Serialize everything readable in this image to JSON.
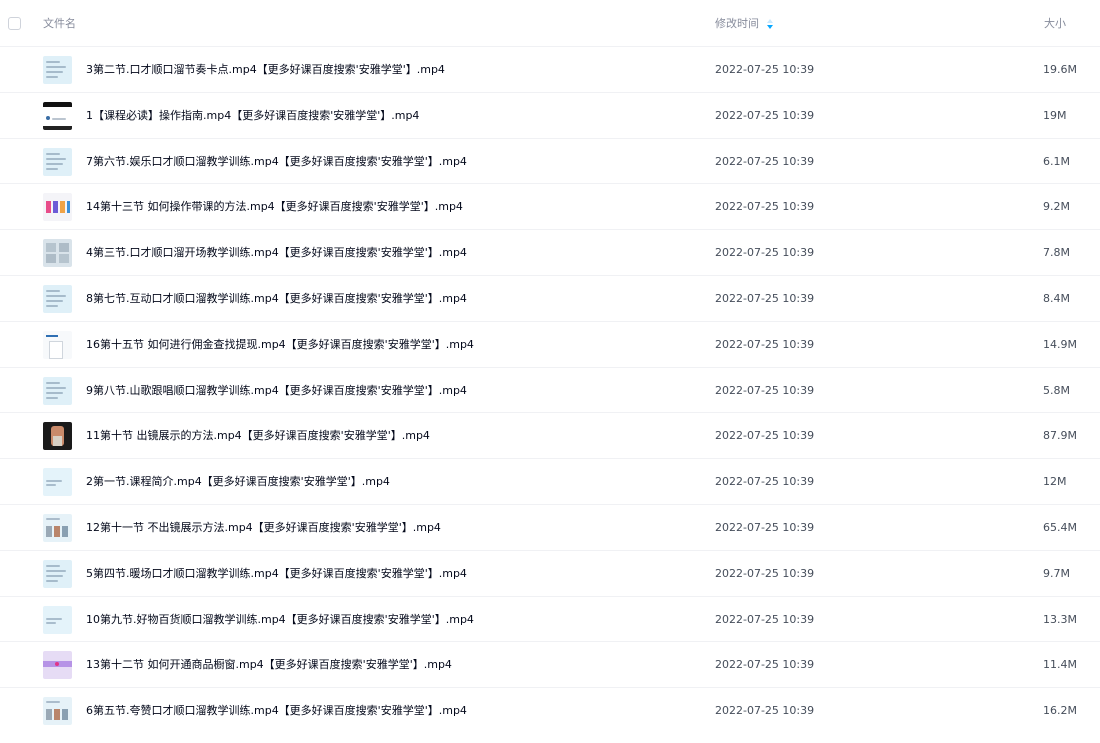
{
  "header": {
    "name_label": "文件名",
    "time_label": "修改时间",
    "size_label": "大小"
  },
  "colors": {
    "accent": "#06a7ff",
    "header_text": "#878c9c",
    "name_text": "#03081a",
    "meta_text": "#454d5a",
    "divider": "#f0f1f4"
  },
  "files": [
    {
      "name": "3第二节.口才顺口溜节奏卡点.mp4【更多好课百度搜索'安雅学堂'】.mp4",
      "time": "2022-07-25 10:39",
      "size": "19.6M",
      "thumb": "slide-light"
    },
    {
      "name": "1【课程必读】操作指南.mp4【更多好课百度搜索'安雅学堂'】.mp4",
      "time": "2022-07-25 10:39",
      "size": "19M",
      "thumb": "dark-phone"
    },
    {
      "name": "7第六节.娱乐口才顺口溜教学训练.mp4【更多好课百度搜索'安雅学堂'】.mp4",
      "time": "2022-07-25 10:39",
      "size": "6.1M",
      "thumb": "slide-light"
    },
    {
      "name": "14第十三节 如何操作带课的方法.mp4【更多好课百度搜索'安雅学堂'】.mp4",
      "time": "2022-07-25 10:39",
      "size": "9.2M",
      "thumb": "colorful"
    },
    {
      "name": "4第三节.口才顺口溜开场教学训练.mp4【更多好课百度搜索'安雅学堂'】.mp4",
      "time": "2022-07-25 10:39",
      "size": "7.8M",
      "thumb": "grid-gray"
    },
    {
      "name": "8第七节.互动口才顺口溜教学训练.mp4【更多好课百度搜索'安雅学堂'】.mp4",
      "time": "2022-07-25 10:39",
      "size": "8.4M",
      "thumb": "slide-light"
    },
    {
      "name": "16第十五节 如何进行佣金查找提现.mp4【更多好课百度搜索'安雅学堂'】.mp4",
      "time": "2022-07-25 10:39",
      "size": "14.9M",
      "thumb": "white-doc"
    },
    {
      "name": "9第八节.山歌跟唱顺口溜教学训练.mp4【更多好课百度搜索'安雅学堂'】.mp4",
      "time": "2022-07-25 10:39",
      "size": "5.8M",
      "thumb": "slide-light"
    },
    {
      "name": "11第十节 出镜展示的方法.mp4【更多好课百度搜索'安雅学堂'】.mp4",
      "time": "2022-07-25 10:39",
      "size": "87.9M",
      "thumb": "photo"
    },
    {
      "name": "2第一节.课程简介.mp4【更多好课百度搜索'安雅学堂'】.mp4",
      "time": "2022-07-25 10:39",
      "size": "12M",
      "thumb": "slide-plain"
    },
    {
      "name": "12第十一节 不出镜展示方法.mp4【更多好课百度搜索'安雅学堂'】.mp4",
      "time": "2022-07-25 10:39",
      "size": "65.4M",
      "thumb": "slide-images"
    },
    {
      "name": "5第四节.暖场口才顺口溜教学训练.mp4【更多好课百度搜索'安雅学堂'】.mp4",
      "time": "2022-07-25 10:39",
      "size": "9.7M",
      "thumb": "slide-light"
    },
    {
      "name": "10第九节.好物百货顺口溜教学训练.mp4【更多好课百度搜索'安雅学堂'】.mp4",
      "time": "2022-07-25 10:39",
      "size": "13.3M",
      "thumb": "slide-plain"
    },
    {
      "name": "13第十二节 如何开通商品橱窗.mp4【更多好课百度搜索'安雅学堂'】.mp4",
      "time": "2022-07-25 10:39",
      "size": "11.4M",
      "thumb": "purple"
    },
    {
      "name": "6第五节.夸赞口才顺口溜教学训练.mp4【更多好课百度搜索'安雅学堂'】.mp4",
      "time": "2022-07-25 10:39",
      "size": "16.2M",
      "thumb": "slide-images"
    }
  ]
}
